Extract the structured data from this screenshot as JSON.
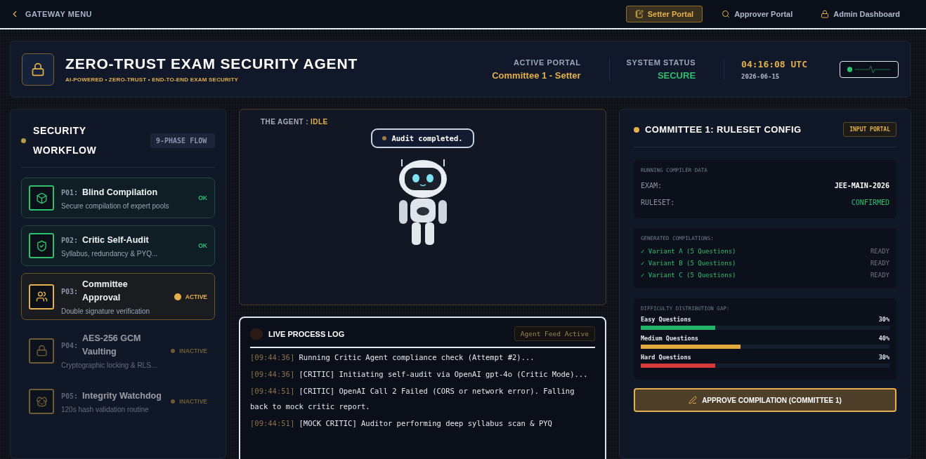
{
  "nav": {
    "back": "GATEWAY MENU",
    "portals": [
      {
        "label": "Setter Portal",
        "selected": true
      },
      {
        "label": "Approver Portal",
        "selected": false
      },
      {
        "label": "Admin Dashboard",
        "selected": false
      }
    ]
  },
  "header": {
    "title": "ZERO-TRUST EXAM SECURITY AGENT",
    "subtitle": "AI-POWERED • ZERO-TRUST • END-TO-END EXAM SECURITY",
    "active_portal_label": "ACTIVE PORTAL",
    "active_portal": "Committee 1 - Setter",
    "status_label": "SYSTEM STATUS",
    "status": "SECURE",
    "time": "04:16:08 UTC",
    "date": "2026-06-15"
  },
  "workflow": {
    "title": "SECURITY WORKFLOW",
    "badge": "9-PHASE FLOW",
    "phases": [
      {
        "code": "P01:",
        "title": "Blind Compilation",
        "desc": "Secure compilation of expert pools",
        "kind": "ok",
        "status_label": "OK"
      },
      {
        "code": "P02:",
        "title": "Critic Self-Audit",
        "desc": "Syllabus, redundancy & PYQ...",
        "kind": "ok",
        "status_label": "OK"
      },
      {
        "code": "P03:",
        "title": "Committee Approval",
        "desc": "Double signature verification",
        "kind": "active",
        "status_label": "ACTIVE"
      },
      {
        "code": "P04:",
        "title": "AES-256 GCM Vaulting",
        "desc": "Cryptographic locking & RLS...",
        "kind": "inactive",
        "status_label": "INACTIVE"
      },
      {
        "code": "P05:",
        "title": "Integrity Watchdog",
        "desc": "120s hash validation routine",
        "kind": "inactive",
        "status_label": "INACTIVE"
      }
    ]
  },
  "agent": {
    "label": "THE AGENT :",
    "state": "IDLE",
    "speech": "Audit completed."
  },
  "log": {
    "title": "LIVE PROCESS LOG",
    "badge": "Agent Feed Active",
    "entries": [
      {
        "time": "[09:44:36]",
        "text": "Running Critic Agent compliance check (Attempt #2)..."
      },
      {
        "time": "[09:44:36]",
        "text": "[CRITIC] Initiating self-audit via OpenAI gpt-4o (Critic Mode)..."
      },
      {
        "time": "[09:44:51]",
        "text": "[CRITIC] OpenAI Call 2 Failed (CORS or network error). Falling back to mock critic report."
      },
      {
        "time": "[09:44:51]",
        "text": "[MOCK CRITIC] Auditor performing deep syllabus scan & PYQ"
      }
    ]
  },
  "config": {
    "title": "COMMITTEE 1: RULESET CONFIG",
    "badge": "INPUT PORTAL",
    "compiler": {
      "title": "RUNNING COMPILER DATA",
      "rows": [
        {
          "label": "EXAM:",
          "value": "JEE-MAIN-2026",
          "kind": "plain"
        },
        {
          "label": "RULESET:",
          "value": "CONFIRMED",
          "kind": "good"
        }
      ]
    },
    "compilations": {
      "title": "GENERATED COMPILATIONS:",
      "items": [
        {
          "check": "✓",
          "label": "Variant A (5 Questions)",
          "status": "READY"
        },
        {
          "check": "✓",
          "label": "Variant B (5 Questions)",
          "status": "READY"
        },
        {
          "check": "✓",
          "label": "Variant C (5 Questions)",
          "status": "READY"
        }
      ]
    },
    "difficulty": {
      "title": "DIFFICULTY DISTRIBUTION GAP:",
      "bars": [
        {
          "label": "Easy Questions",
          "reading": "30%",
          "level": 0.3,
          "color": "#22b46a"
        },
        {
          "label": "Medium Questions",
          "reading": "40%",
          "level": 0.4,
          "color": "#e3a93c"
        },
        {
          "label": "Hard Questions",
          "reading": "30%",
          "level": 0.3,
          "color": "#d63a3a"
        }
      ]
    },
    "action": "APPROVE COMPILATION (COMMITTEE 1)"
  }
}
